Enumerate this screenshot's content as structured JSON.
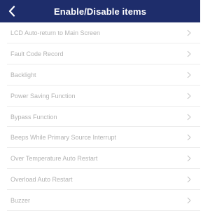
{
  "nav": {
    "title": "Enable/Disable items",
    "back_icon": "chevron-left-icon",
    "bar_color": "#1e2d6b"
  },
  "items": [
    {
      "label": "LCD Auto-return to Main Screen"
    },
    {
      "label": "Fault Code Record"
    },
    {
      "label": "Backlight"
    },
    {
      "label": "Power Saving Function"
    },
    {
      "label": "Bypass Function"
    },
    {
      "label": "Beeps While Primary Source Interrupt"
    },
    {
      "label": "Over Temperature Auto Restart"
    },
    {
      "label": "Overload Auto Restart"
    },
    {
      "label": "Buzzer"
    }
  ],
  "row_icon": "chevron-right-icon"
}
